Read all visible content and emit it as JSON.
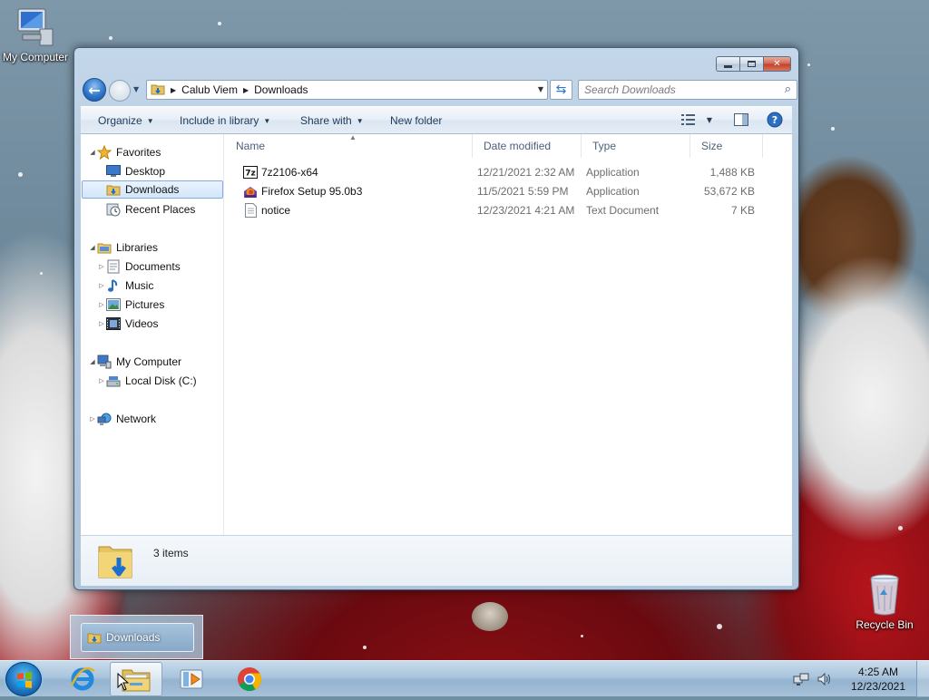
{
  "desktop": {
    "icons": [
      {
        "label": "My Computer",
        "icon": "computer-icon"
      },
      {
        "label": "Recycle Bin",
        "icon": "recycle-bin-icon"
      }
    ]
  },
  "window": {
    "caption_buttons": {
      "minimize": "minimize-icon",
      "maximize": "maximize-icon",
      "close": "close-icon"
    },
    "address": {
      "crumbs": [
        "Calub Viem",
        "Downloads"
      ]
    },
    "search": {
      "placeholder": "Search Downloads"
    },
    "toolbar": {
      "organize": "Organize",
      "include_in_library": "Include in library",
      "share_with": "Share with",
      "new_folder": "New folder"
    },
    "nav": {
      "favorites": "Favorites",
      "desktop": "Desktop",
      "downloads": "Downloads",
      "recent_places": "Recent Places",
      "libraries": "Libraries",
      "documents": "Documents",
      "music": "Music",
      "pictures": "Pictures",
      "videos": "Videos",
      "my_computer": "My Computer",
      "local_disk": "Local Disk (C:)",
      "network": "Network"
    },
    "columns": {
      "name": "Name",
      "date_modified": "Date modified",
      "type": "Type",
      "size": "Size"
    },
    "files": [
      {
        "name": "7z2106-x64",
        "date": "12/21/2021 2:32 AM",
        "type": "Application",
        "size": "1,488 KB",
        "icon": "7zip-icon"
      },
      {
        "name": "Firefox Setup 95.0b3",
        "date": "11/5/2021 5:59 PM",
        "type": "Application",
        "size": "53,672 KB",
        "icon": "firefox-installer-icon"
      },
      {
        "name": "notice",
        "date": "12/23/2021 4:21 AM",
        "type": "Text Document",
        "size": "7 KB",
        "icon": "text-document-icon"
      }
    ],
    "details": {
      "count": "3 items"
    }
  },
  "taskbar": {
    "thumbnail_label": "Downloads",
    "clock": {
      "time": "4:25 AM",
      "date": "12/23/2021"
    },
    "apps": [
      "internet-explorer-icon",
      "windows-explorer-icon",
      "media-player-icon",
      "chrome-icon"
    ]
  },
  "colors": {
    "selection": "#d2e6fb",
    "accent": "#1e395b",
    "taskbar": "#a9c4dc"
  }
}
